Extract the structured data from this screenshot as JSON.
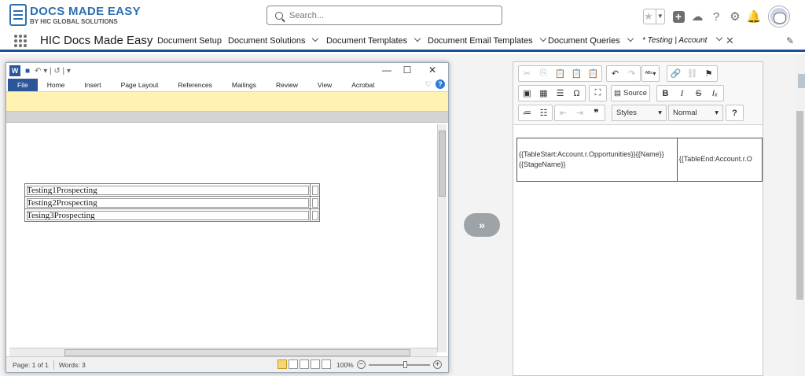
{
  "header": {
    "logo": {
      "title": "DOCS MADE EASY",
      "subtitle": "BY HIC GLOBAL SOLUTIONS"
    },
    "search": {
      "placeholder": "Search..."
    },
    "icons": [
      "favorites-star-icon",
      "global-actions-plus-icon",
      "trailhead-icon",
      "help-icon",
      "setup-gear-icon",
      "notifications-bell-icon",
      "avatar"
    ]
  },
  "nav": {
    "app_name": "HIC Docs Made Easy",
    "items": [
      {
        "label": "Document Setup"
      },
      {
        "label": "Document Solutions"
      },
      {
        "label": "Document Templates"
      },
      {
        "label": "Document Email Templates"
      },
      {
        "label": "Document Queries"
      }
    ],
    "active_tab": {
      "label": "* Testing | Account"
    }
  },
  "word": {
    "quick_access": "↶ ▾ | ↺ | ▾",
    "ribbon_tabs": [
      "File",
      "Home",
      "Insert",
      "Page Layout",
      "References",
      "Mailings",
      "Review",
      "View",
      "Acrobat"
    ],
    "rows": [
      {
        "text": "Testing1Prospecting"
      },
      {
        "text": "Testing2Prospecting"
      },
      {
        "text": "Tesing3Prospecting"
      }
    ],
    "status": {
      "page": "Page: 1 of 1",
      "words": "Words: 3",
      "zoom": "100%"
    }
  },
  "arrow": {
    "label": "»"
  },
  "editor": {
    "toolbar": {
      "source_label": "Source",
      "styles_label": "Styles",
      "format_label": "Normal",
      "help_label": "?"
    },
    "table": {
      "cell1": "{{TableStart:Account.r.Opportunities}}{{Name}} {{StageName}}",
      "cell2": "{{TableEnd:Account.r.O"
    }
  },
  "colors": {
    "brand": "#2f6fb0",
    "nav_border": "#1b5297",
    "word_blue": "#2b579a",
    "ribbon_yellow": "#fff2b3"
  }
}
